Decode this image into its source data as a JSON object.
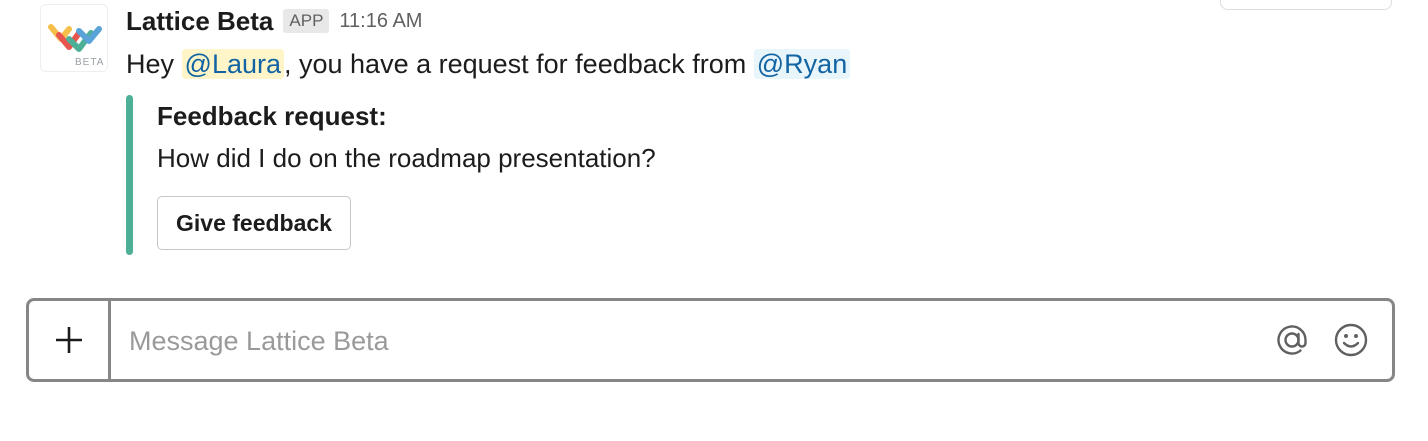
{
  "message": {
    "sender": "Lattice Beta",
    "app_badge": "APP",
    "time": "11:16 AM",
    "avatar_badge": "BETA",
    "body": {
      "prefix": "Hey ",
      "mention_me": "@Laura",
      "middle": ", you have a request for feedback from ",
      "mention_other": "@Ryan"
    },
    "attachment": {
      "title": "Feedback request:",
      "text": "How did I do on the roadmap presentation?",
      "button_label": "Give feedback",
      "accent_color": "#4caf96"
    }
  },
  "composer": {
    "placeholder": "Message Lattice Beta",
    "value": "",
    "icons": [
      "plus-icon",
      "at-icon",
      "emoji-icon"
    ]
  },
  "colors": {
    "mention_text": "#1264a3",
    "mention_self_bg": "#fff5c8",
    "mention_other_bg": "#e8f5fa"
  }
}
